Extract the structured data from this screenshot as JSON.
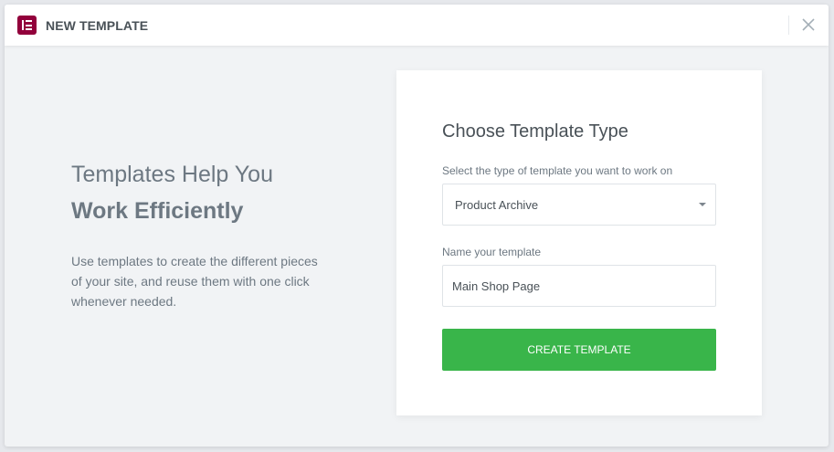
{
  "header": {
    "title": "NEW TEMPLATE",
    "logo_color": "#92003b"
  },
  "intro": {
    "title_line1": "Templates Help You",
    "title_line2": "Work Efficiently",
    "description": "Use templates to create the different pieces of your site, and reuse them with one click whenever needed."
  },
  "form": {
    "title": "Choose Template Type",
    "type_label": "Select the type of template you want to work on",
    "type_value": "Product Archive",
    "name_label": "Name your template",
    "name_value": "Main Shop Page",
    "submit_label": "CREATE TEMPLATE",
    "submit_color": "#39b54a"
  },
  "icons": {
    "logo": "elementor-logo-icon",
    "close": "close-icon",
    "caret": "caret-down-icon"
  }
}
